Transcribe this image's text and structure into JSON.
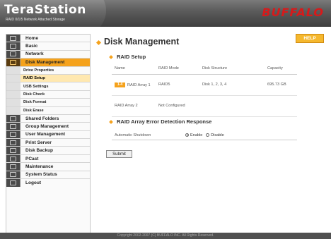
{
  "header": {
    "logo_title": "TeraStation",
    "logo_subtitle": "RAID 0/1/5 Network Attached Storage",
    "brand": "BUFFALO"
  },
  "sidebar": {
    "items": [
      {
        "label": "Home",
        "icon": "home-icon"
      },
      {
        "label": "Basic",
        "icon": "basic-icon"
      },
      {
        "label": "Network",
        "icon": "network-icon"
      },
      {
        "label": "Disk Management",
        "icon": "disk-icon",
        "active": true
      },
      {
        "label": "Drive Properties",
        "sub": true
      },
      {
        "label": "RAID Setup",
        "sub": true,
        "active": true
      },
      {
        "label": "USB Settings",
        "sub": true
      },
      {
        "label": "Disk Check",
        "sub": true
      },
      {
        "label": "Disk Format",
        "sub": true
      },
      {
        "label": "Disk Erase",
        "sub": true
      },
      {
        "label": "Shared Folders",
        "icon": "folder-icon"
      },
      {
        "label": "Group Management",
        "icon": "group-icon"
      },
      {
        "label": "User Management",
        "icon": "user-icon"
      },
      {
        "label": "Print Server",
        "icon": "printer-icon"
      },
      {
        "label": "Disk Backup",
        "icon": "backup-icon"
      },
      {
        "label": "PCast",
        "icon": "pcast-icon"
      },
      {
        "label": "Maintenance",
        "icon": "maintenance-icon"
      },
      {
        "label": "System Status",
        "icon": "status-icon"
      },
      {
        "label": "Logout",
        "icon": "logout-icon"
      }
    ]
  },
  "main": {
    "title": "Disk Management",
    "help_label": "HELP",
    "raid_setup": {
      "title": "RAID Setup",
      "columns": [
        "Name",
        "RAID Mode",
        "Disk Structure",
        "Capacity"
      ],
      "rows": [
        {
          "badge": "1-4",
          "name": "RAID Array 1",
          "mode": "RAID5",
          "structure": "Disk 1, 2, 3, 4",
          "capacity": "695.73 GB"
        },
        {
          "badge": "",
          "name": "RAID Array 2",
          "mode": "Not Configured",
          "structure": "",
          "capacity": ""
        }
      ]
    },
    "error_detection": {
      "title": "RAID Array Error Detection Response",
      "setting_label": "Automatic Shutdown",
      "enable_label": "Enable",
      "disable_label": "Disable",
      "selected": "Enable"
    },
    "submit_label": "Submit"
  },
  "footer": {
    "copyright": "Copyright 2002-2007 (C) BUFFALO INC. All Rights Reserved."
  },
  "colors": {
    "accent": "#f5a21c",
    "brand_red": "#d8191a",
    "header_dark": "#4a4a4a"
  }
}
